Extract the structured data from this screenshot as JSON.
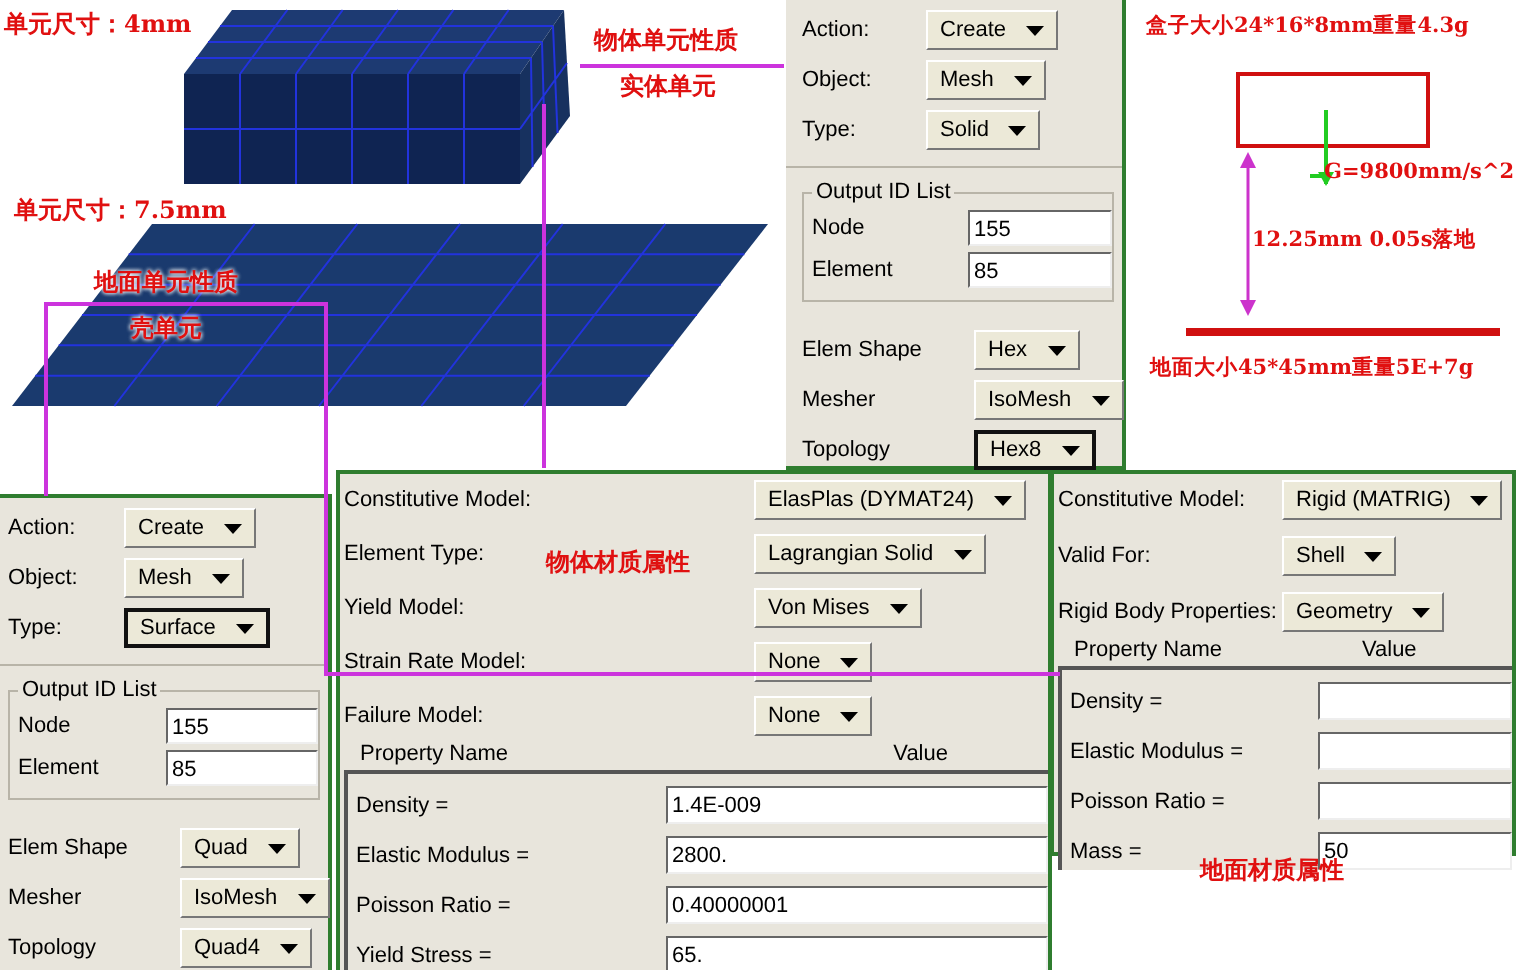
{
  "mesh_view": {
    "box_element_size": "单元尺寸：4mm",
    "plate_element_size": "单元尺寸：7.5mm",
    "box_property_title": "物体单元性质",
    "box_property_type": "实体单元",
    "ground_property_title": "地面单元性质",
    "ground_property_type": "壳单元"
  },
  "solid_mesh_panel": {
    "fields": [
      {
        "label": "Action:",
        "value": "Create",
        "focused": false
      },
      {
        "label": "Object:",
        "value": "Mesh",
        "focused": false
      },
      {
        "label": "Type:",
        "value": "Solid",
        "focused": false
      }
    ],
    "output_id_list": {
      "title": "Output ID List",
      "rows": [
        {
          "label": "Node",
          "value": "155"
        },
        {
          "label": "Element",
          "value": "85"
        }
      ]
    },
    "mesh_fields": [
      {
        "label": "Elem Shape",
        "value": "Hex",
        "focused": false
      },
      {
        "label": "Mesher",
        "value": "IsoMesh",
        "focused": false
      },
      {
        "label": "Topology",
        "value": "Hex8",
        "focused": true
      }
    ]
  },
  "drop_diagram": {
    "box_label": "盒子大小24*16*8mm重量4.3g",
    "gravity_label": "G=9800mm/s^2",
    "drop_label": "12.25mm  0.05s落地",
    "ground_label": "地面大小45*45mm重量5E+7g"
  },
  "surface_mesh_panel": {
    "fields": [
      {
        "label": "Action:",
        "value": "Create",
        "focused": false
      },
      {
        "label": "Object:",
        "value": "Mesh",
        "focused": false
      },
      {
        "label": "Type:",
        "value": "Surface",
        "focused": true
      }
    ],
    "output_id_list": {
      "title": "Output ID List",
      "rows": [
        {
          "label": "Node",
          "value": "155"
        },
        {
          "label": "Element",
          "value": "85"
        }
      ]
    },
    "mesh_fields": [
      {
        "label": "Elem Shape",
        "value": "Quad",
        "focused": false
      },
      {
        "label": "Mesher",
        "value": "IsoMesh",
        "focused": false
      },
      {
        "label": "Topology",
        "value": "Quad4",
        "focused": false
      }
    ]
  },
  "box_material_panel": {
    "label": "物体材质属性",
    "options": [
      {
        "label": "Constitutive Model:",
        "value": "ElasPlas (DYMAT24)"
      },
      {
        "label": "Element Type:",
        "value": "Lagrangian Solid"
      },
      {
        "label": "Yield Model:",
        "value": "Von Mises"
      },
      {
        "label": "Strain Rate Model:",
        "value": "None"
      },
      {
        "label": "Failure Model:",
        "value": "None"
      }
    ],
    "columns": [
      "Property Name",
      "Value"
    ],
    "rows": [
      {
        "name": "Density =",
        "value": "1.4E-009"
      },
      {
        "name": "Elastic Modulus =",
        "value": "2800."
      },
      {
        "name": "Poisson Ratio =",
        "value": "0.40000001"
      },
      {
        "name": "Yield Stress =",
        "value": "65."
      }
    ]
  },
  "ground_material_panel": {
    "label": "地面材质属性",
    "options": [
      {
        "label": "Constitutive Model:",
        "value": "Rigid (MATRIG)"
      },
      {
        "label": "Valid For:",
        "value": "Shell"
      },
      {
        "label": "Rigid Body Properties:",
        "value": "Geometry"
      }
    ],
    "columns": [
      "Property Name",
      "Value"
    ],
    "rows": [
      {
        "name": "Density ="
      },
      {
        "name": "Elastic Modulus ="
      },
      {
        "name": "Poisson Ratio ="
      },
      {
        "name": "Mass =",
        "value": "50"
      }
    ]
  }
}
